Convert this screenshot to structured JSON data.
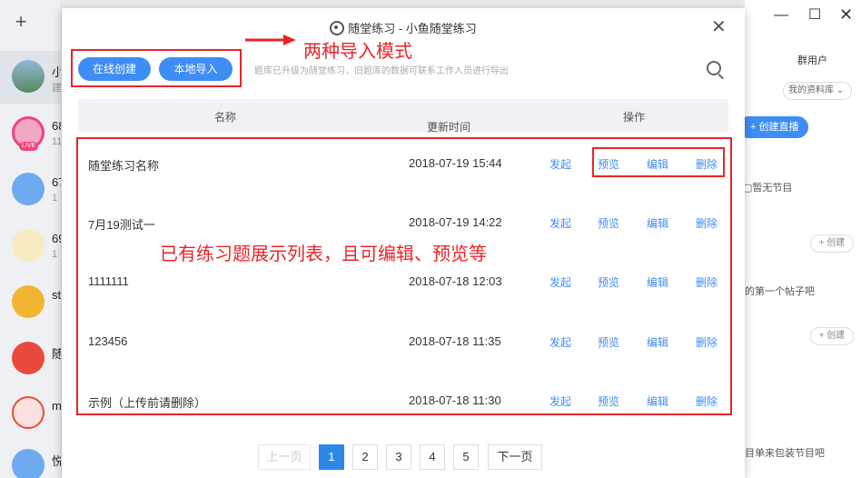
{
  "background": {
    "sidebar": {
      "conversations": [
        {
          "name": "小",
          "sub": "建"
        },
        {
          "name": "68",
          "sub": "11",
          "live": "LIVE"
        },
        {
          "name": "67",
          "sub": "1"
        },
        {
          "name": "69",
          "sub": "1"
        },
        {
          "name": "st",
          "sub": ""
        },
        {
          "name": "随",
          "sub": ""
        },
        {
          "name": "m",
          "sub": ""
        },
        {
          "name": "悦",
          "sub": ""
        }
      ]
    },
    "right": {
      "tab": "群用户",
      "dropdown": "我的资料库",
      "live_button": "创建直播",
      "no_program": "暂无节目",
      "create": "+ 创建",
      "post_text": "的第一个帖子吧",
      "bottom_text": "目单来包装节目吧"
    }
  },
  "dialog": {
    "title": "随堂练习 - 小鱼随堂练习",
    "buttons": {
      "online_create": "在线创建",
      "local_import": "本地导入"
    },
    "hint": "题库已升级为随堂练习，旧题库的数据可联系工作人员进行导出",
    "table": {
      "headers": {
        "name": "名称",
        "updated": "更新时间",
        "sort_icon": "↓",
        "actions": "操作"
      },
      "actions": {
        "launch": "发起",
        "preview": "预览",
        "edit": "编辑",
        "delete": "删除"
      },
      "rows": [
        {
          "name": "随堂练习名称",
          "time": "2018-07-19 15:44"
        },
        {
          "name": "7月19测试一",
          "time": "2018-07-19 14:22"
        },
        {
          "name": "1111111",
          "time": "2018-07-18 12:03"
        },
        {
          "name": "123456",
          "time": "2018-07-18 11:35"
        },
        {
          "name": "示例（上传前请删除）",
          "time": "2018-07-18 11:30"
        }
      ]
    },
    "pagination": {
      "prev": "上一页",
      "pages": [
        "1",
        "2",
        "3",
        "4",
        "5"
      ],
      "next": "下一页",
      "current": "1"
    }
  },
  "annotations": {
    "import_modes": "两种导入模式",
    "list_note": "已有练习题展示列表，且可编辑、预览等"
  },
  "colors": {
    "accent": "#3d8df5",
    "annotation_red": "#e8242a"
  }
}
